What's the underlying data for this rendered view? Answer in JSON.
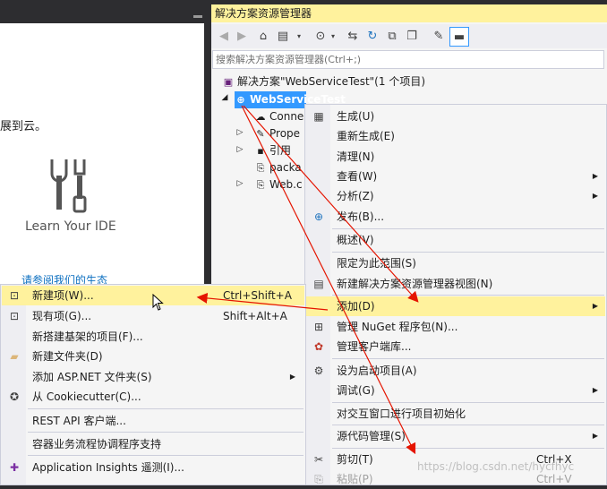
{
  "left_pane": {
    "text_partial": "展到云。",
    "learn_label": "Learn Your IDE",
    "link_partial": "请参阅我们的生态"
  },
  "solution_explorer": {
    "title": "解决方案资源管理器",
    "search_placeholder": "搜索解决方案资源管理器(Ctrl+;)",
    "tree": {
      "solution": "解决方案\"WebServiceTest\"(1 个项目)",
      "project": "WebServiceTest",
      "children": [
        "Conne",
        "Prope",
        "引用",
        "packa",
        "Web.c"
      ]
    }
  },
  "context_menu": {
    "items": [
      {
        "label": "生成(U)"
      },
      {
        "label": "重新生成(E)"
      },
      {
        "label": "清理(N)"
      },
      {
        "label": "查看(W)"
      },
      {
        "label": "分析(Z)"
      },
      {
        "label": "发布(B)..."
      },
      {
        "label": "概述(V)"
      },
      {
        "label": "限定为此范围(S)"
      },
      {
        "label": "新建解决方案资源管理器视图(N)"
      },
      {
        "label": "添加(D)"
      },
      {
        "label": "管理 NuGet 程序包(N)..."
      },
      {
        "label": "管理客户端库..."
      },
      {
        "label": "设为启动项目(A)"
      },
      {
        "label": "调试(G)"
      },
      {
        "label": "对交互窗口进行项目初始化"
      },
      {
        "label": "源代码管理(S)"
      },
      {
        "label": "剪切(T)",
        "shortcut": "Ctrl+X"
      },
      {
        "label": "粘贴(P)",
        "shortcut": "Ctrl+V"
      }
    ]
  },
  "add_menu": {
    "items": [
      {
        "label": "新建项(W)...",
        "shortcut": "Ctrl+Shift+A"
      },
      {
        "label": "现有项(G)...",
        "shortcut": "Shift+Alt+A"
      },
      {
        "label": "新搭建基架的项目(F)..."
      },
      {
        "label": "新建文件夹(D)"
      },
      {
        "label": "添加 ASP.NET 文件夹(S)"
      },
      {
        "label": "从 Cookiecutter(C)..."
      },
      {
        "label": "REST API 客户端..."
      },
      {
        "label": "容器业务流程协调程序支持"
      },
      {
        "label": "Application Insights 遥测(I)..."
      }
    ]
  },
  "watermark": "https://blog.csdn.net/hycfhyc",
  "colors": {
    "highlight": "#fff29d",
    "selection": "#3399ff",
    "arrow": "#e51400",
    "background_dark": "#2d2d30"
  }
}
